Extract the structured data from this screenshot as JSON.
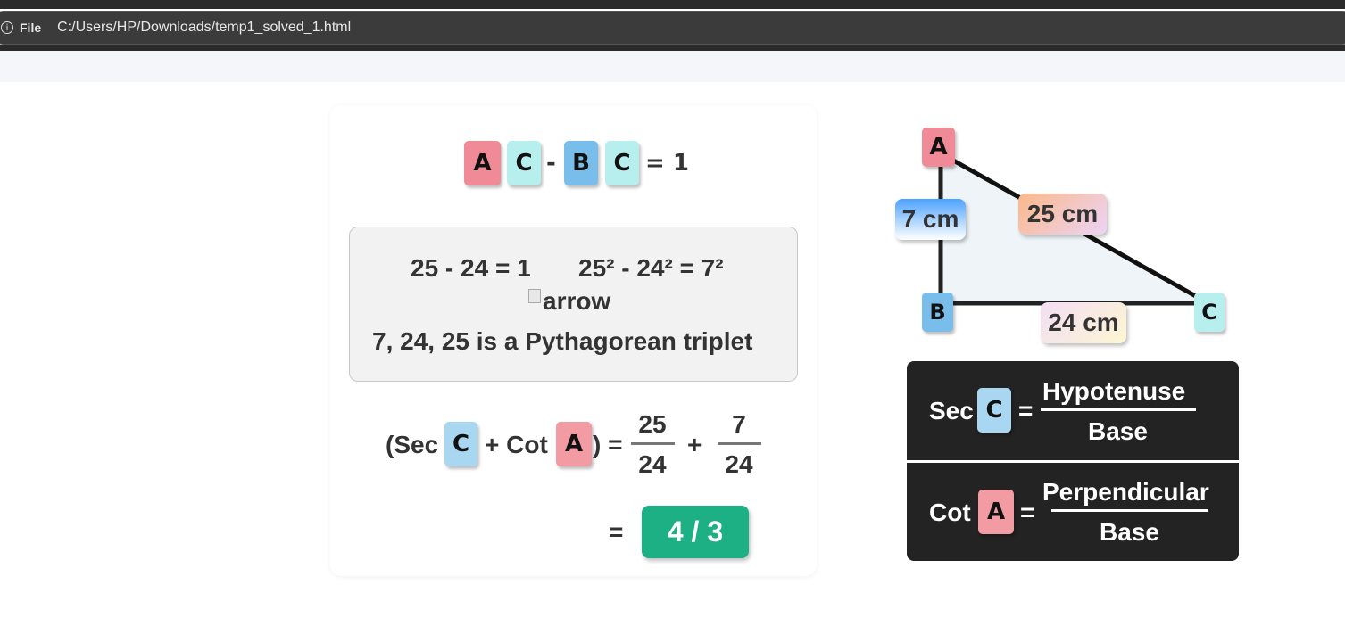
{
  "browser": {
    "info_icon": "info-icon",
    "file_label": "File",
    "url": "C:/Users/HP/Downloads/temp1_solved_1.html"
  },
  "equation_top": {
    "chips": [
      "A",
      "C",
      "B",
      "C"
    ],
    "minus": "-",
    "equals_one": "= 1"
  },
  "gray_box": {
    "line1a": "25 - 24 = 1",
    "line1b": "25² - 24² = 7²",
    "broken_image_alt": "arrow",
    "line3": "7, 24, 25 is a Pythagorean triplet"
  },
  "expression": {
    "open": "(Sec",
    "chip_c": "C",
    "plus_cot": "+ Cot",
    "chip_a": "A",
    "close_eq": ") =",
    "frac1_num": "25",
    "frac1_den": "24",
    "plus": "+",
    "frac2_num": "7",
    "frac2_den": "24",
    "equals": "=",
    "answer": "4 / 3"
  },
  "triangle": {
    "vertex_a": "A",
    "vertex_b": "B",
    "vertex_c": "C",
    "side_ab": "7 cm",
    "side_ac": "25 cm",
    "side_bc": "24 cm"
  },
  "formulas": {
    "sec_label": "Sec",
    "sec_chip": "C",
    "sec_eq": "=",
    "sec_num": "Hypotenuse",
    "sec_den": "Base",
    "cot_label": "Cot",
    "cot_chip": "A",
    "cot_eq": "=",
    "cot_num": "Perpendicular",
    "cot_den": "Base"
  }
}
